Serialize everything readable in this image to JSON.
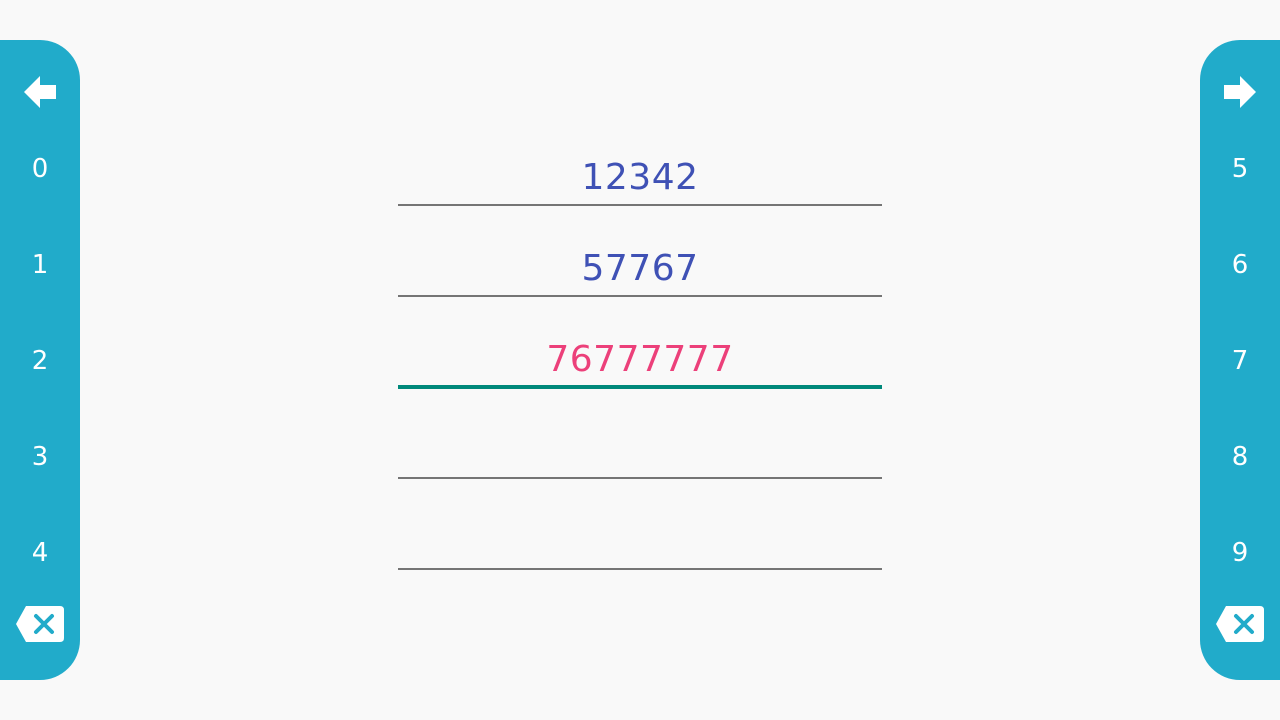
{
  "keypad": {
    "left": {
      "keys": [
        "0",
        "1",
        "2",
        "3",
        "4"
      ],
      "arrow_icon": "arrow-left-icon",
      "delete_icon": "backspace-icon"
    },
    "right": {
      "keys": [
        "5",
        "6",
        "7",
        "8",
        "9"
      ],
      "arrow_icon": "arrow-right-icon",
      "delete_icon": "backspace-icon"
    },
    "colors": {
      "panel": "#21abca",
      "key_text": "#ffffff"
    }
  },
  "entries": [
    {
      "value": "12342",
      "active": false
    },
    {
      "value": "57767",
      "active": false
    },
    {
      "value": "76777777",
      "active": true
    },
    {
      "value": "",
      "active": false
    },
    {
      "value": "",
      "active": false
    }
  ],
  "colors": {
    "entry_text": "#3f51b5",
    "active_entry_text": "#ec407a",
    "active_underline": "#00897b",
    "underline": "#757575",
    "background": "#f9f9f9"
  }
}
